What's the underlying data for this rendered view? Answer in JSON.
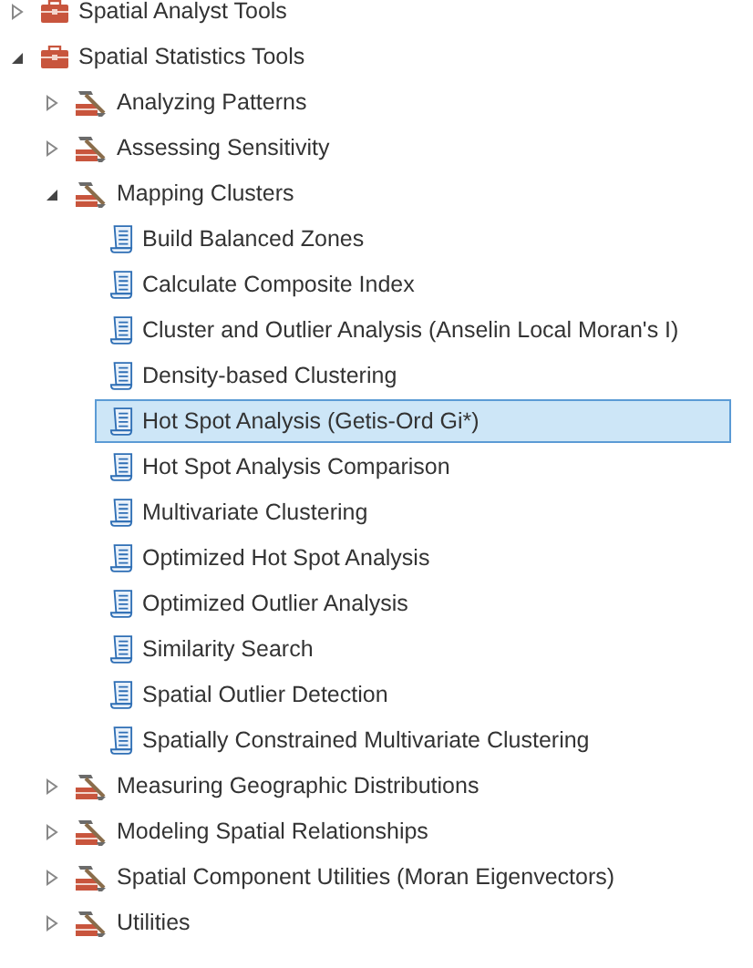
{
  "tree": [
    {
      "kind": "toolbox",
      "label": "Spatial Analyst Tools",
      "expanded": false
    },
    {
      "kind": "toolbox",
      "label": "Spatial Statistics Tools",
      "expanded": true,
      "children": [
        {
          "kind": "toolset",
          "label": "Analyzing Patterns",
          "expanded": false
        },
        {
          "kind": "toolset",
          "label": "Assessing Sensitivity",
          "expanded": false
        },
        {
          "kind": "toolset",
          "label": "Mapping Clusters",
          "expanded": true,
          "children": [
            {
              "kind": "tool",
              "label": "Build Balanced Zones",
              "selected": false
            },
            {
              "kind": "tool",
              "label": "Calculate Composite Index",
              "selected": false
            },
            {
              "kind": "tool",
              "label": "Cluster and Outlier Analysis (Anselin Local Moran's I)",
              "selected": false
            },
            {
              "kind": "tool",
              "label": "Density-based Clustering",
              "selected": false
            },
            {
              "kind": "tool",
              "label": "Hot Spot Analysis (Getis-Ord Gi*)",
              "selected": true
            },
            {
              "kind": "tool",
              "label": "Hot Spot Analysis Comparison",
              "selected": false
            },
            {
              "kind": "tool",
              "label": "Multivariate Clustering",
              "selected": false
            },
            {
              "kind": "tool",
              "label": "Optimized Hot Spot Analysis",
              "selected": false
            },
            {
              "kind": "tool",
              "label": "Optimized Outlier Analysis",
              "selected": false
            },
            {
              "kind": "tool",
              "label": "Similarity Search",
              "selected": false
            },
            {
              "kind": "tool",
              "label": "Spatial Outlier Detection",
              "selected": false
            },
            {
              "kind": "tool",
              "label": "Spatially Constrained Multivariate Clustering",
              "selected": false
            }
          ]
        },
        {
          "kind": "toolset",
          "label": "Measuring Geographic Distributions",
          "expanded": false
        },
        {
          "kind": "toolset",
          "label": "Modeling Spatial Relationships",
          "expanded": false
        },
        {
          "kind": "toolset",
          "label": "Spatial Component Utilities (Moran Eigenvectors)",
          "expanded": false
        },
        {
          "kind": "toolset",
          "label": "Utilities",
          "expanded": false
        }
      ]
    }
  ]
}
